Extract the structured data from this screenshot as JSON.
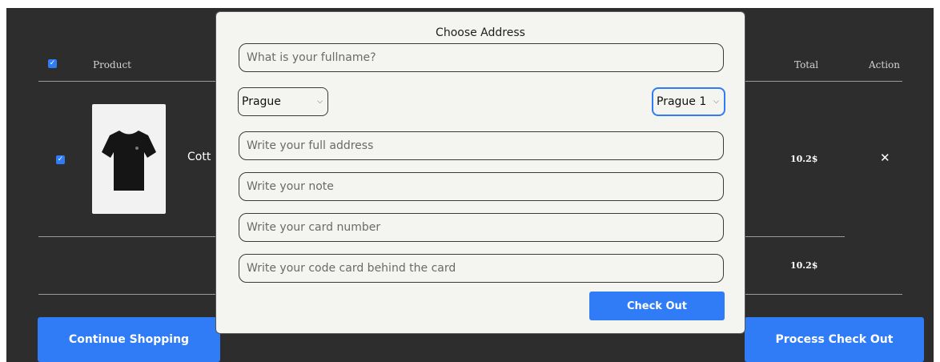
{
  "cart": {
    "header": {
      "product": "Product",
      "total": "Total",
      "action": "Action"
    },
    "item": {
      "name_partial": "Cott",
      "total": "10.2$",
      "remove_icon": "close-icon",
      "image_icon": "tshirt-icon",
      "checked": true
    },
    "summary_total": "10.2$",
    "continue_label": "Continue Shopping",
    "process_label": "Process Check Out"
  },
  "modal": {
    "title": "Choose Address",
    "fullname_placeholder": "What is your fullname?",
    "city_value": "Prague",
    "district_value": "Prague 1",
    "address_placeholder": "Write your full address",
    "note_placeholder": "Write your note",
    "card_placeholder": "Write your card number",
    "code_placeholder": "Write your code card behind the card",
    "checkout_label": "Check Out"
  },
  "colors": {
    "accent": "#2f7cf6",
    "panel_bg": "#2d2d2d",
    "modal_bg": "#f4f4f1"
  }
}
